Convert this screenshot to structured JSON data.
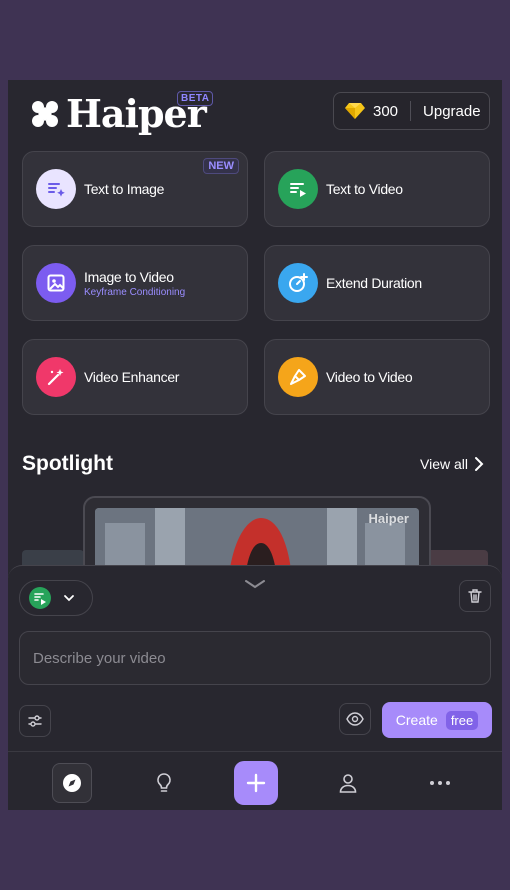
{
  "header": {
    "brand": "Haiper",
    "beta_badge": "BETA",
    "credits": "300",
    "upgrade_label": "Upgrade"
  },
  "tools": [
    {
      "label": "Text to Image",
      "badge": "NEW",
      "icon": "text-image-icon",
      "color": "#e9e4ff"
    },
    {
      "label": "Text to Video",
      "icon": "text-video-icon",
      "color": "#27a35a"
    },
    {
      "label": "Image to Video",
      "sub": "Keyframe Conditioning",
      "icon": "image-icon",
      "color": "#7c5cf0"
    },
    {
      "label": "Extend Duration",
      "icon": "timer-plus-icon",
      "color": "#3aa7ef"
    },
    {
      "label": "Video Enhancer",
      "icon": "magic-wand-icon",
      "color": "#f0386a"
    },
    {
      "label": "Video to Video",
      "icon": "brush-icon",
      "color": "#f5a51a"
    }
  ],
  "spotlight": {
    "title": "Spotlight",
    "view_all": "View all",
    "watermark": "Haiper"
  },
  "composer": {
    "placeholder": "Describe your video",
    "create_label": "Create",
    "free_label": "free"
  },
  "colors": {
    "accent": "#a78bfa",
    "background": "#28272f",
    "outer": "#3f3353"
  },
  "nav": [
    "compass-icon",
    "lightbulb-icon",
    "plus-icon",
    "user-icon",
    "more-icon"
  ]
}
